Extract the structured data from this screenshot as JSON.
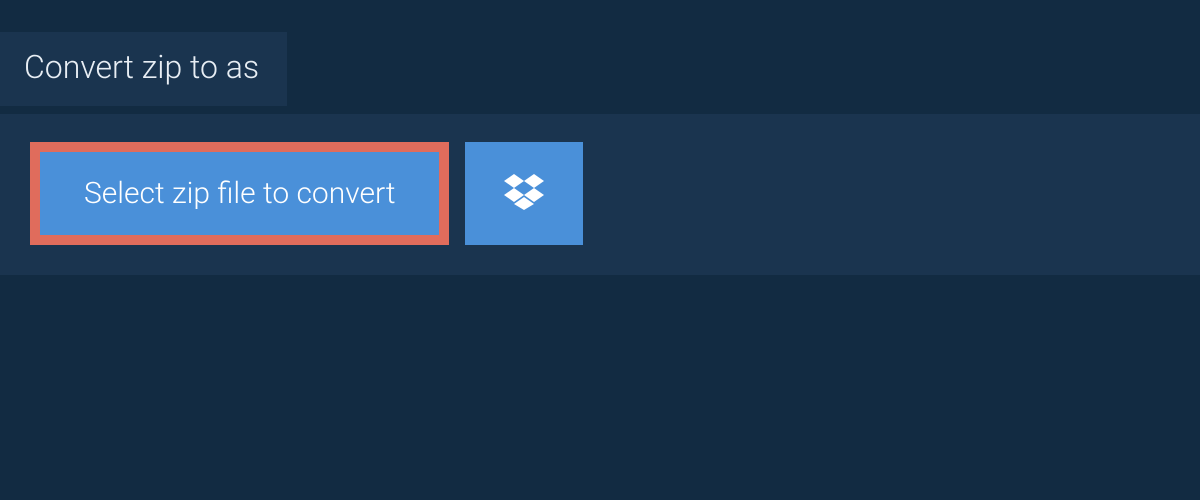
{
  "tab": {
    "title": "Convert zip to as"
  },
  "panel": {
    "select_button_label": "Select zip file to convert"
  },
  "colors": {
    "background": "#122b42",
    "panel": "#1a344f",
    "button": "#4a90d9",
    "highlight_border": "#e06c5c",
    "text_light": "#e8eef4",
    "text_white": "#ffffff"
  }
}
